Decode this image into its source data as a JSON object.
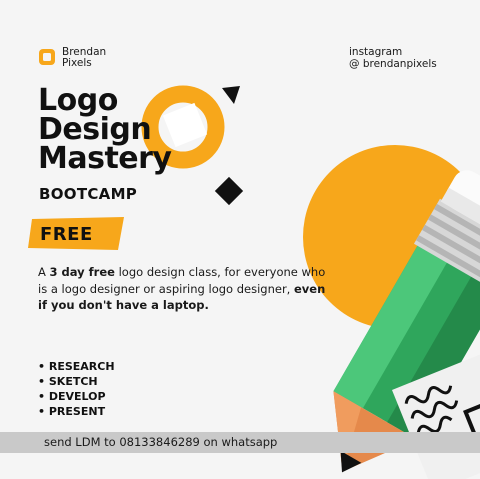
{
  "brand": {
    "line1": "Brendan",
    "line2": "Pixels"
  },
  "social": {
    "line1": "instagram",
    "line2": "@ brendanpixels"
  },
  "title": {
    "line1": "Logo",
    "line2": "Design",
    "line3": "Mastery"
  },
  "subtitle": "BOOTCAMP",
  "badge": "FREE",
  "description": {
    "part1": "A ",
    "bold1": "3 day free",
    "part2": " logo design class, for everyone who is a logo designer or aspiring logo designer, ",
    "bold2": "even if you don't have a laptop."
  },
  "steps": [
    "RESEARCH",
    "SKETCH",
    "DEVELOP",
    "PRESENT"
  ],
  "footer": "send LDM to 08133846289 on whatsapp",
  "colors": {
    "accent": "#f7a71b",
    "pencil_green": "#3cb86a",
    "dark": "#111111"
  }
}
